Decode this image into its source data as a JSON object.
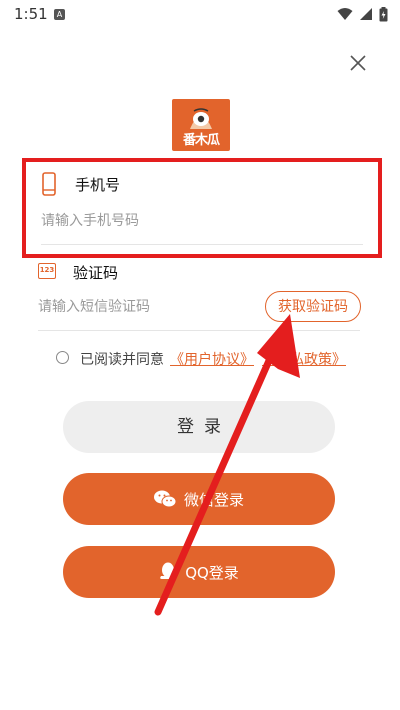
{
  "status_bar": {
    "time": "1:51",
    "notification_letter": "A"
  },
  "logo": {
    "text": "番木瓜"
  },
  "phone": {
    "label": "手机号",
    "placeholder": "请输入手机号码",
    "value": ""
  },
  "code": {
    "label": "验证码",
    "icon_text": "123",
    "placeholder": "请输入短信验证码",
    "value": "",
    "get_code_label": "获取验证码"
  },
  "agreement": {
    "prefix": "已阅读并同意",
    "user_agreement": "《用户协议》",
    "privacy_policy": "《隐私政策》",
    "checked": false
  },
  "buttons": {
    "login": "登录",
    "wechat_login": "微信登录",
    "qq_login": "QQ登录"
  },
  "colors": {
    "accent": "#e2642c",
    "annotation_red": "#e41e1e",
    "login_bg": "#eeeeee"
  },
  "icons": [
    "wifi-icon",
    "signal-icon",
    "battery-icon",
    "close-icon",
    "phone-icon",
    "sms-code-icon",
    "wechat-icon",
    "qq-icon"
  ]
}
